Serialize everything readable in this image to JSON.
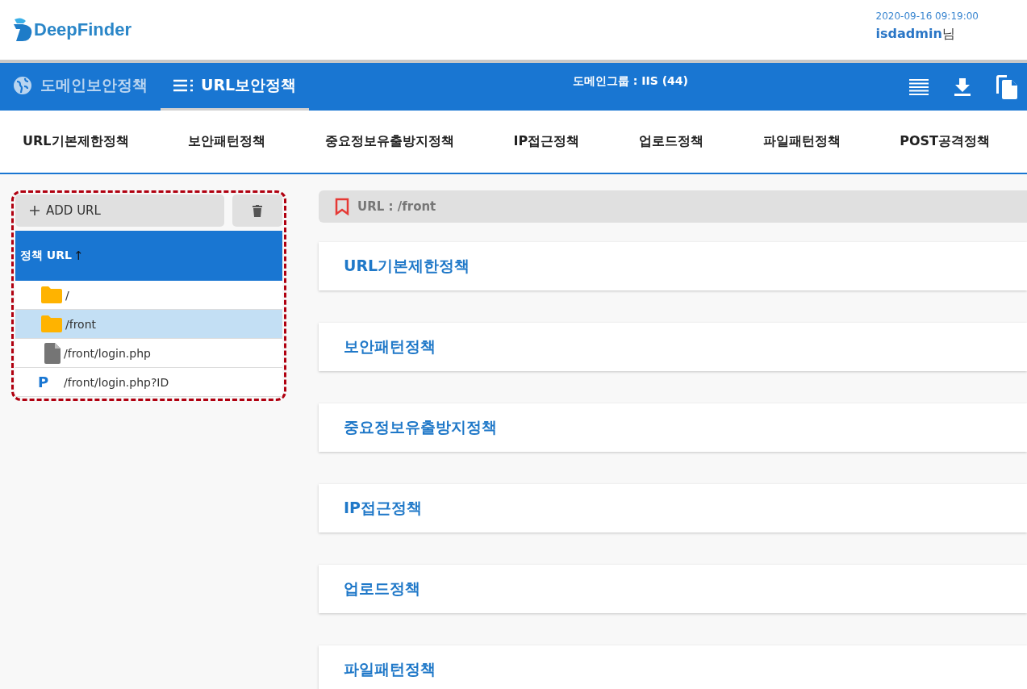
{
  "header": {
    "logo": "DeepFinder",
    "datetime": "2020-09-16 09:19:00",
    "user": "isdadmin",
    "user_suffix": "님"
  },
  "nav": {
    "tabs": [
      {
        "label": "도메인보안정책",
        "kind": "globe",
        "selected": false
      },
      {
        "label": "URL보안정책",
        "kind": "list",
        "selected": true
      }
    ],
    "group_label": "도메인그룹 : IIS (44)"
  },
  "policy_tabs": [
    "URL기본제한정책",
    "보안패턴정책",
    "중요정보유출방지정책",
    "IP접근정책",
    "업로드정책",
    "파일패턴정책",
    "POST공격정책"
  ],
  "url_panel": {
    "add_button": "ADD URL",
    "header": "정책 URL",
    "sort_arrow": "↑",
    "items": [
      {
        "label": "/",
        "kind": "folder",
        "selected": false
      },
      {
        "label": "/front",
        "kind": "folder",
        "selected": true
      },
      {
        "label": "/front/login.php",
        "kind": "file",
        "selected": false
      },
      {
        "label": "/front/login.php?ID",
        "kind": "param",
        "icon_text": "P",
        "selected": false
      }
    ]
  },
  "current_url": "URL : /front",
  "sections": [
    "URL기본제한정책",
    "보안패턴정책",
    "중요정보유출방지정책",
    "IP접근정책",
    "업로드정책",
    "파일패턴정책"
  ]
}
